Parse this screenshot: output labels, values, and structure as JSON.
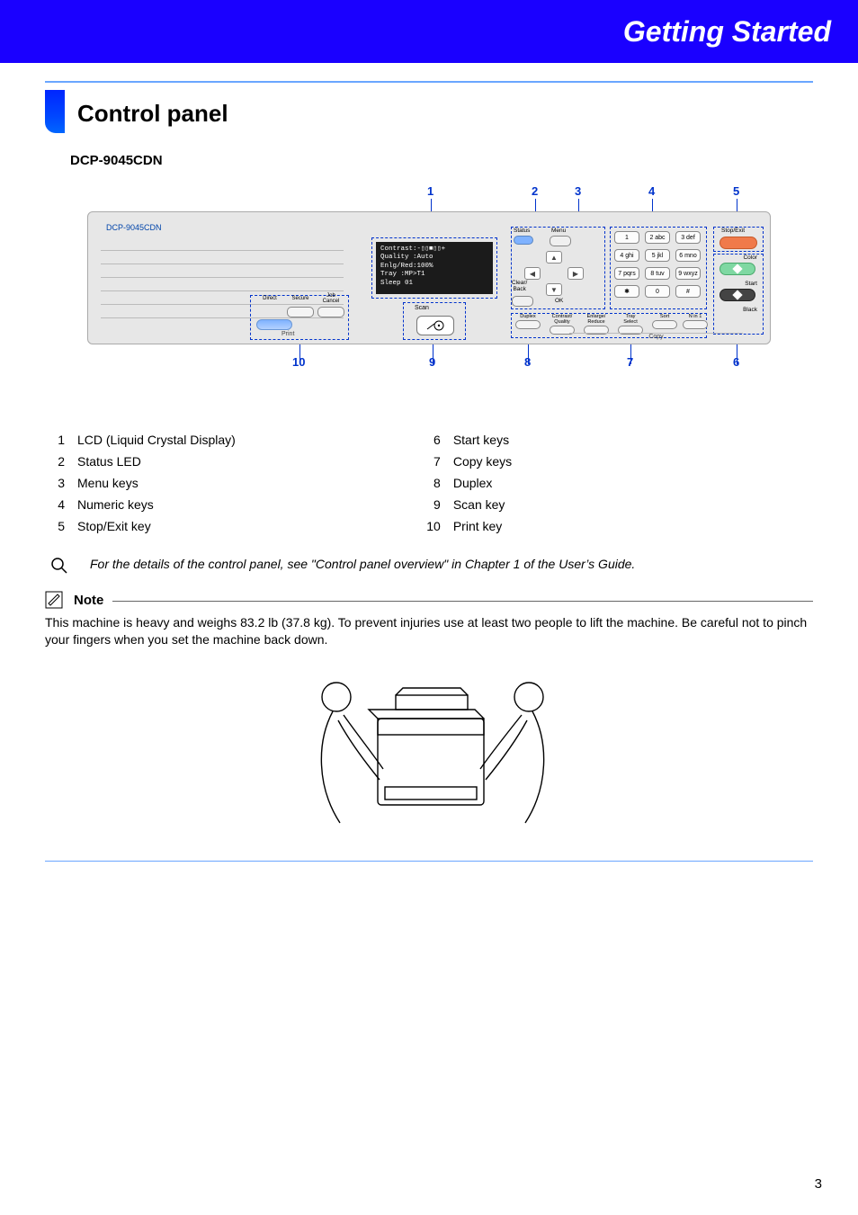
{
  "banner": {
    "title": "Getting Started"
  },
  "section": {
    "title": "Control panel"
  },
  "model": "DCP-9045CDN",
  "panel": {
    "model_label": "DCP-9045CDN",
    "lcd_lines": {
      "l1": "Contrast:-▯▯■▯▯+",
      "l2": "Quality :Auto",
      "l3": "Enlg/Red:100%",
      "l4": "Tray    :MP>T1",
      "l5": "Sleep          01"
    },
    "labels": {
      "status": "Status",
      "menu": "Menu",
      "clear_back": "Clear/\nBack",
      "ok": "OK",
      "scan": "Scan",
      "direct": "Direct",
      "secure": "Secure",
      "job_cancel": "Job\nCancel",
      "print": "Print",
      "stop_exit": "Stop/Exit",
      "color": "Color",
      "start": "Start",
      "black": "Black",
      "duplex": "Duplex",
      "contrast_quality": "Contrast/\nQuality",
      "enlarge_reduce": "Enlarge/\nReduce",
      "tray_select": "Tray\nSelect",
      "sort": "Sort",
      "n_in_1": "N in 1",
      "copy": "Copy"
    },
    "numpad": {
      "k1": "1",
      "k2": "2 abc",
      "k3": "3 def",
      "k4": "4 ghi",
      "k5": "5 jkl",
      "k6": "6 mno",
      "k7": "7 pqrs",
      "k8": "8 tuv",
      "k9": "9 wxyz",
      "ks": "✱",
      "k0": "0",
      "kp": "#"
    },
    "arrows": {
      "up": "▲",
      "down": "▼",
      "left": "◀",
      "right": "▶"
    }
  },
  "callouts": {
    "top": {
      "c1": "1",
      "c2": "2",
      "c3": "3",
      "c4": "4",
      "c5": "5"
    },
    "bot": {
      "c6": "6",
      "c7": "7",
      "c8": "8",
      "c9": "9",
      "c10": "10"
    }
  },
  "legend": {
    "left": [
      {
        "n": "1",
        "t": "LCD (Liquid Crystal Display)"
      },
      {
        "n": "2",
        "t": "Status LED"
      },
      {
        "n": "3",
        "t": "Menu keys"
      },
      {
        "n": "4",
        "t": "Numeric keys"
      },
      {
        "n": "5",
        "t": "Stop/Exit key"
      }
    ],
    "right": [
      {
        "n": "6",
        "t": "Start keys"
      },
      {
        "n": "7",
        "t": "Copy keys"
      },
      {
        "n": "8",
        "t": "Duplex"
      },
      {
        "n": "9",
        "t": "Scan key"
      },
      {
        "n": "10",
        "t": "Print key"
      }
    ]
  },
  "info_text": "For the details of the control panel, see \"Control panel overview\" in Chapter 1 of the User’s Guide.",
  "note": {
    "heading": "Note",
    "body": "This machine is heavy and weighs 83.2 lb (37.8 kg). To prevent injuries use at least two people to lift the machine. Be careful not to pinch your fingers when you set the machine back down."
  },
  "page_number": "3"
}
